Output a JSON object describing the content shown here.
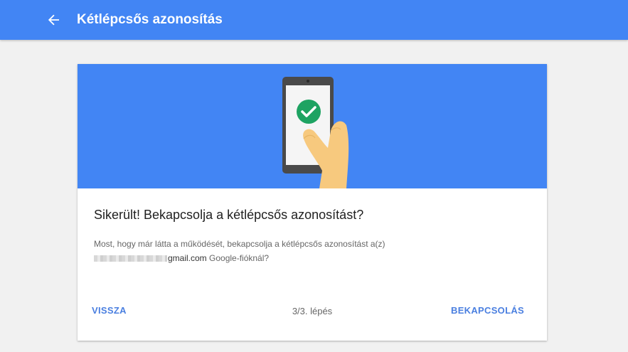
{
  "header": {
    "title": "Kétlépcsős azonosítás",
    "back_icon": "arrow-back-icon",
    "color": "#4285f4"
  },
  "card": {
    "illustration": "phone-with-checkmark-illustration",
    "heading": "Sikerült! Bekapcsolja a kétlépcsős azonosítást?",
    "body_line1": "Most, hogy már látta a működését, bekapcsolja a kétlépcsős azonosítást a(z)",
    "email_domain": "gmail.com",
    "body_line2_suffix": " Google-fióknál?",
    "back_label": "VISSZA",
    "step_label": "3/3. lépés",
    "turn_on_label": "BEKAPCSOLÁS",
    "accent": "#4a7fe0",
    "success_color": "#1ea362"
  }
}
